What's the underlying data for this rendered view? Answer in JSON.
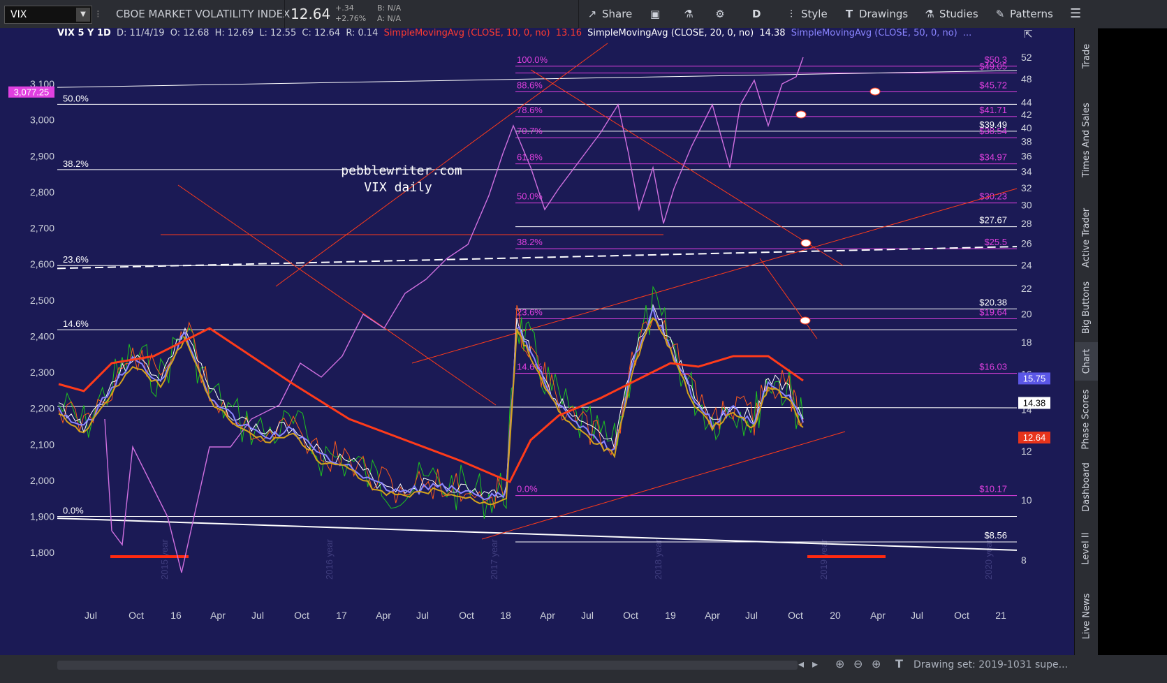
{
  "toolbar": {
    "symbol": "VIX",
    "name": "CBOE MARKET VOLATILITY INDEX",
    "price": "12.64",
    "change": "+.34",
    "change_pct": "+2.76%",
    "bid": "B: N/A",
    "ask": "A: N/A",
    "share": "Share",
    "timeframe": "D",
    "style": "Style",
    "drawings": "Drawings",
    "studies": "Studies",
    "patterns": "Patterns"
  },
  "header": {
    "title": "VIX 5 Y 1D",
    "date": "D: 11/4/19",
    "open": "O: 12.68",
    "high": "H: 12.69",
    "low": "L: 12.55",
    "close": "C: 12.64",
    "range": "R: 0.14",
    "sma10": "SimpleMovingAvg (CLOSE, 10, 0, no)",
    "sma10_val": "13.16",
    "sma20": "SimpleMovingAvg (CLOSE, 20, 0, no)",
    "sma20_val": "14.38",
    "sma50": "SimpleMovingAvg (CLOSE, 50, 0, no)",
    "sma50_val": "...",
    "colors": {
      "sma10": "#ff3b30",
      "sma20": "#ffffff",
      "sma50": "#8a85ff"
    }
  },
  "side_tabs": [
    "Trade",
    "Times And Sales",
    "Active Trader",
    "Big Buttons",
    "Chart",
    "Phase Scores",
    "Dashboard",
    "Level II",
    "Live News"
  ],
  "bottom": {
    "status": "Drawing set: 2019-1031 supe..."
  },
  "chart_data": {
    "type": "line",
    "title": "pebblewriter.com",
    "subtitle": "VIX daily",
    "left_axis": {
      "ticks": [
        3100,
        3000,
        2900,
        2800,
        2700,
        2600,
        2500,
        2400,
        2300,
        2200,
        2100,
        2000,
        1900,
        1800
      ],
      "tick_labels": [
        "3,100",
        "3,000",
        "2,900",
        "2,800",
        "2,700",
        "2,600",
        "2,500",
        "2,400",
        "2,300",
        "2,200",
        "2,100",
        "2,000",
        "1,900",
        "1,800"
      ],
      "last_badge": "3,077.25"
    },
    "right_axis": {
      "ticks": [
        52,
        48,
        44,
        42,
        40,
        38,
        36,
        34,
        32,
        30,
        28,
        26,
        24,
        22,
        20,
        18,
        16,
        14,
        12,
        10,
        8
      ],
      "scale": "log",
      "badges": [
        {
          "label": "15.75",
          "value": 15.75,
          "color": "#5b57e6"
        },
        {
          "label": "14.38",
          "value": 14.38,
          "color": "#ffffff"
        },
        {
          "label": "12.64",
          "value": 12.64,
          "color": "#e8341c"
        }
      ]
    },
    "x_axis": {
      "labels": [
        "Jul",
        "Oct",
        "16",
        "Apr",
        "Jul",
        "Oct",
        "17",
        "Apr",
        "Jul",
        "Oct",
        "18",
        "Apr",
        "Jul",
        "Oct",
        "19",
        "Apr",
        "Jul",
        "Oct",
        "20",
        "Apr",
        "Jul",
        "Oct",
        "21"
      ],
      "year_watermarks": [
        "2015 year",
        "2016 year",
        "2017 year",
        "2018 year",
        "2019 year",
        "2020 year"
      ]
    },
    "fib_left": [
      {
        "label": "50.0%",
        "spx": 3043
      },
      {
        "label": "38.2%",
        "spx": 2862
      },
      {
        "label": "23.6%",
        "spx": 2596
      },
      {
        "label": "14.6%",
        "spx": 2418
      },
      {
        "label": "0.0%",
        "spx": 1900
      }
    ],
    "fib_vix": [
      {
        "label": "100.0%",
        "price_label": "$50.3",
        "vix": 50.3
      },
      {
        "label": "",
        "price_label": "$49.05",
        "vix": 49.05
      },
      {
        "label": "88.6%",
        "price_label": "$45.72",
        "vix": 45.72
      },
      {
        "label": "78.6%",
        "price_label": "$41.71",
        "vix": 41.71
      },
      {
        "label": "",
        "price_label": "$39.49",
        "vix": 39.49
      },
      {
        "label": "70.7%",
        "price_label": "$38.54",
        "vix": 38.54
      },
      {
        "label": "61.8%",
        "price_label": "$34.97",
        "vix": 34.97
      },
      {
        "label": "50.0%",
        "price_label": "$30.23",
        "vix": 30.23
      },
      {
        "label": "",
        "price_label": "$27.67",
        "vix": 27.67
      },
      {
        "label": "38.2%",
        "price_label": "$25.5",
        "vix": 25.5
      },
      {
        "label": "23.6%",
        "price_label": "$19.64",
        "vix": 19.64
      },
      {
        "label": "",
        "price_label": "$20.38",
        "vix": 20.38
      },
      {
        "label": "14.6%",
        "price_label": "$16.03",
        "vix": 16.03
      },
      {
        "label": "0.0%",
        "price_label": "$10.17",
        "vix": 10.17
      },
      {
        "label": "",
        "price_label": "$8.56",
        "vix": 8.56
      }
    ],
    "series": [
      {
        "name": "SimpleMovingAvg (CLOSE, 10, 0, no)",
        "color": "#ffffff"
      },
      {
        "name": "SimpleMovingAvg (CLOSE, 20, 0, no)",
        "color": "#8a85ff"
      },
      {
        "name": "SimpleMovingAvg (CLOSE, 50, 0, no)",
        "color": "#d4a21c"
      },
      {
        "name": "",
        "color": "#ff3b1a"
      }
    ],
    "colors": {
      "background": "#1b1a55",
      "fib": "#e040e0",
      "spx_line": "#d070e0",
      "channel": "#ff3b1a"
    }
  }
}
